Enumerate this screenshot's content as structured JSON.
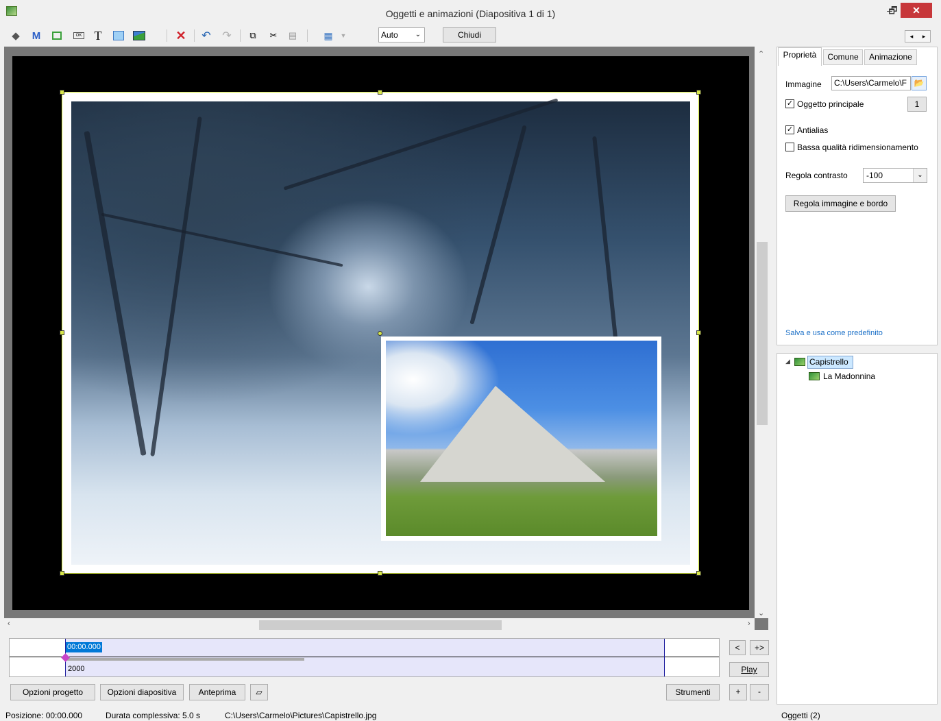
{
  "window": {
    "title": "Oggetti e animazioni  (Diapositiva 1 di 1)",
    "min": "–",
    "max": "🗗",
    "close": "✕"
  },
  "toolbar": {
    "icons": [
      "camera-icon",
      "mask-icon",
      "frame-icon",
      "button-icon",
      "text-icon",
      "rectangle-icon",
      "image-icon",
      "delete-icon",
      "undo-icon",
      "redo-icon",
      "copy-icon",
      "cut-icon",
      "paste-icon",
      "grid-icon"
    ],
    "m_label": "M",
    "t_label": "T",
    "zoom_value": "Auto",
    "close_label": "Chiudi"
  },
  "right_panel": {
    "tabs": [
      "Proprietà",
      "Comune",
      "Animazione"
    ],
    "image_label": "Immagine",
    "image_path": "C:\\Users\\Carmelo\\F",
    "main_object_label": "Oggetto principale",
    "main_object_checked": true,
    "main_object_num": "1",
    "antialias_label": "Antialias",
    "antialias_checked": true,
    "low_quality_label": "Bassa qualità ridimensionamento",
    "low_quality_checked": false,
    "contrast_label": "Regola contrasto",
    "contrast_value": "-100",
    "adjust_button": "Regola immagine e bordo",
    "save_default": "Salva e usa come predefinito"
  },
  "tree": {
    "items": [
      {
        "label": "Capistrello"
      },
      {
        "label": "La Madonnina"
      }
    ]
  },
  "timeline": {
    "time": "00:00.000",
    "value": "2000",
    "prev": "<",
    "next": "+>",
    "play": "Play",
    "plus": "+",
    "minus": "-"
  },
  "bottom_buttons": {
    "project_options": "Opzioni progetto",
    "slide_options": "Opzioni diapositiva",
    "preview": "Anteprima",
    "tools": "Strumenti"
  },
  "status": {
    "position": "Posizione:  00:00.000",
    "duration": "Durata complessiva:  5.0 s",
    "path": "C:\\Users\\Carmelo\\Pictures\\Capistrello.jpg",
    "objects": "Oggetti (2)"
  }
}
